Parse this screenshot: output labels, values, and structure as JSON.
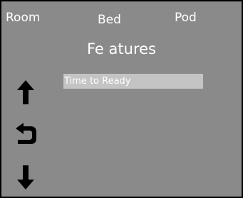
{
  "tabs": {
    "room": "Room",
    "bed": "Bed",
    "pod": "Pod"
  },
  "page": {
    "title": "Fe atures"
  },
  "menu": {
    "items": [
      {
        "label": "Time to Ready",
        "selected": true
      }
    ]
  },
  "nav": {
    "up_icon": "arrow-up-icon",
    "back_icon": "return-arrow-icon",
    "down_icon": "arrow-down-icon"
  },
  "colors": {
    "background": "#8a8a8a",
    "text": "#ffffff",
    "selected_item": "#c4c4c4",
    "icons": "#000000"
  }
}
